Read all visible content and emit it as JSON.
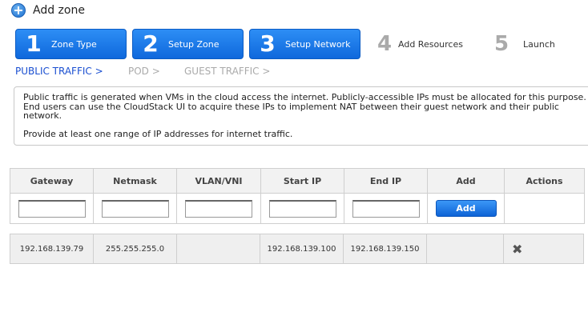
{
  "header": {
    "title": "Add zone",
    "icon": "plus-circle-icon"
  },
  "steps": [
    {
      "number": "1",
      "label": "Zone Type",
      "state": "active"
    },
    {
      "number": "2",
      "label": "Setup Zone",
      "state": "active"
    },
    {
      "number": "3",
      "label": "Setup Network",
      "state": "active"
    },
    {
      "number": "4",
      "label": "Add Resources",
      "state": "inactive"
    },
    {
      "number": "5",
      "label": "Launch",
      "state": "inactive"
    }
  ],
  "subnav": [
    {
      "label": "PUBLIC TRAFFIC >",
      "state": "active"
    },
    {
      "label": "POD >",
      "state": "inactive"
    },
    {
      "label": "GUEST TRAFFIC >",
      "state": "inactive"
    }
  ],
  "info": {
    "para1": "Public traffic is generated when VMs in the cloud access the internet. Publicly-accessible IPs must be allocated for this purpose. End users can use the CloudStack UI to acquire these IPs to implement NAT between their guest network and their public network.",
    "para2": "Provide at least one range of IP addresses for internet traffic."
  },
  "table": {
    "columns": [
      "Gateway",
      "Netmask",
      "VLAN/VNI",
      "Start IP",
      "End IP",
      "Add",
      "Actions"
    ],
    "inputs": {
      "gateway": "",
      "netmask": "",
      "vlan": "",
      "start_ip": "",
      "end_ip": ""
    },
    "add_label": "Add",
    "rows": [
      {
        "gateway": "192.168.139.79",
        "netmask": "255.255.255.0",
        "vlan": "",
        "start_ip": "192.168.139.100",
        "end_ip": "192.168.139.150",
        "action_icon": "close-icon",
        "action_glyph": "✖"
      }
    ]
  },
  "colors": {
    "accent": "#1a6fe0",
    "active_link": "#1a4fd1",
    "inactive": "#aaaaaa"
  }
}
